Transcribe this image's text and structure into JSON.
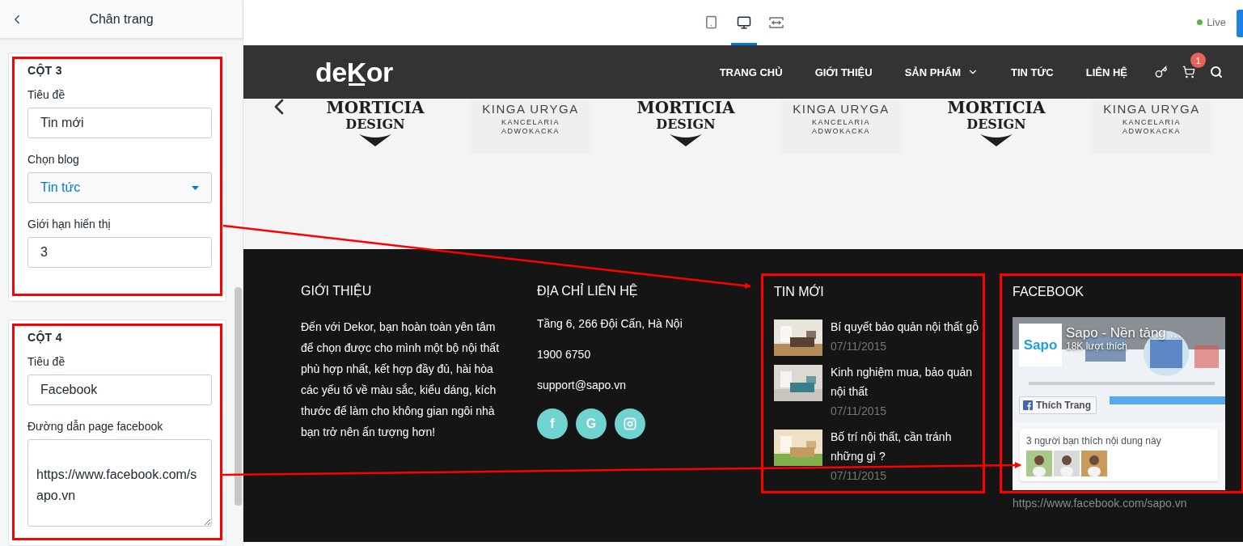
{
  "sidebar": {
    "title": "Chân trang",
    "sections": [
      {
        "heading": "CỘT 3",
        "fields": [
          {
            "kind": "text",
            "label": "Tiêu đề",
            "value": "Tin mới"
          },
          {
            "kind": "select",
            "label": "Chọn blog",
            "value": "Tin tức"
          },
          {
            "kind": "text",
            "label": "Giới hạn hiển thị",
            "value": "3"
          }
        ]
      },
      {
        "heading": "CỘT 4",
        "fields": [
          {
            "kind": "text",
            "label": "Tiêu đề",
            "value": "Facebook"
          },
          {
            "kind": "textarea",
            "label": "Đường dẫn page facebook",
            "value": "https://www.facebook.com/sapo.vn"
          }
        ]
      }
    ]
  },
  "toolbar": {
    "devices": [
      {
        "kind": "tablet",
        "selected": false
      },
      {
        "kind": "desktop",
        "selected": true
      },
      {
        "kind": "fullwidth",
        "selected": false
      }
    ],
    "status": "Live"
  },
  "site": {
    "logo": "deKor",
    "nav": [
      {
        "label": "TRANG CHỦ",
        "dropdown": false
      },
      {
        "label": "GIỚI THIỆU",
        "dropdown": false
      },
      {
        "label": "SẢN PHẨM",
        "dropdown": true
      },
      {
        "label": "TIN TỨC",
        "dropdown": false
      },
      {
        "label": "LIÊN HỆ",
        "dropdown": false
      }
    ],
    "cart_count": "1",
    "brands": [
      {
        "kind": "morticia",
        "lines": [
          "MORTICIA",
          "DESIGN"
        ]
      },
      {
        "kind": "kinga",
        "lines": [
          "KINGA URYGA",
          "KANCELARIA",
          "ADWOKACKA"
        ]
      },
      {
        "kind": "morticia",
        "lines": [
          "MORTICIA",
          "DESIGN"
        ]
      },
      {
        "kind": "kinga",
        "lines": [
          "KINGA URYGA",
          "KANCELARIA",
          "ADWOKACKA"
        ]
      },
      {
        "kind": "morticia",
        "lines": [
          "MORTICIA",
          "DESIGN"
        ]
      },
      {
        "kind": "kinga",
        "lines": [
          "KINGA URYGA",
          "KANCELARIA",
          "ADWOKACKA"
        ]
      }
    ],
    "footer": {
      "about": {
        "title": "GIỚI THIỆU",
        "text": "Đến với Dekor, bạn hoàn toàn yên tâm để chọn được cho mình một bộ nội thất phù hợp nhất, kết hợp đầy đủ, hài hòa các yếu tố về màu sắc, kiểu dáng, kích thước để làm cho không gian ngôi nhà bạn trở nên ấn tượng hơn!"
      },
      "contact": {
        "title": "ĐỊA CHỈ LIÊN HỆ",
        "lines": [
          "Tầng 6, 266 Đội Cấn, Hà Nội",
          "1900 6750",
          "support@sapo.vn"
        ],
        "socials": [
          {
            "kind": "facebook",
            "label": "f"
          },
          {
            "kind": "google",
            "label": "G"
          },
          {
            "kind": "instagram"
          }
        ]
      },
      "news": {
        "title": "TIN MỚI",
        "posts": [
          {
            "title": "Bí quyết bảo quản nội thất gỗ",
            "date": "07/11/2015"
          },
          {
            "title": "Kinh nghiệm mua, bảo quản nội thất",
            "date": "07/11/2015"
          },
          {
            "title": "Bố trí nội thất, cần tránh những gì ?",
            "date": "07/11/2015"
          }
        ]
      },
      "facebook": {
        "title": "FACEBOOK",
        "page_logo": "Sapo",
        "page_name": "Sapo - Nền tảng ...",
        "likes": "18K lượt thích",
        "like_button": "Thích Trang",
        "friends_text": "3 người bạn thích nội dung này",
        "url": "https://www.facebook.com/sapo.vn"
      }
    }
  }
}
